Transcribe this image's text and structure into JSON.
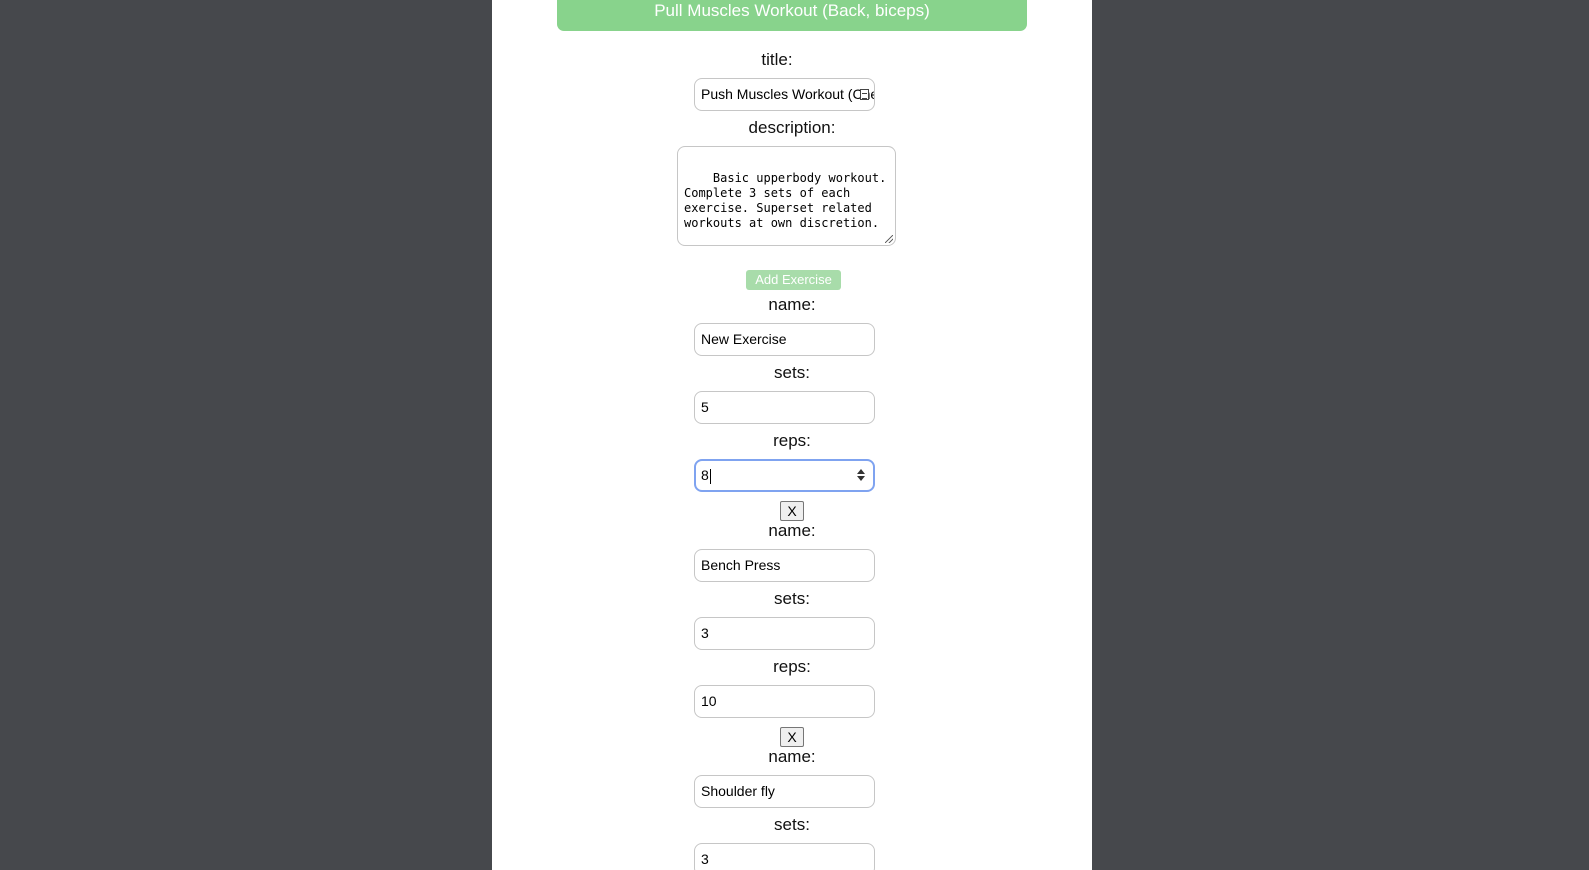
{
  "header": {
    "workout_title": "Pull Muscles Workout (Back, biceps)"
  },
  "form": {
    "title_label": "title:",
    "title_value": "Push Muscles Workout (Che",
    "description_label": "description:",
    "description_value": "Basic upperbody workout.\nComplete 3 sets of each\nexercise. Superset related\nworkouts at own discretion.",
    "add_exercise_label": "Add Exercise"
  },
  "exercises": [
    {
      "name_label": "name:",
      "name_value": "New Exercise",
      "sets_label": "sets:",
      "sets_value": "5",
      "reps_label": "reps:",
      "reps_value": "8",
      "remove_label": "X"
    },
    {
      "name_label": "name:",
      "name_value": "Bench Press",
      "sets_label": "sets:",
      "sets_value": "3",
      "reps_label": "reps:",
      "reps_value": "10",
      "remove_label": "X"
    },
    {
      "name_label": "name:",
      "name_value": "Shoulder fly",
      "sets_label": "sets:",
      "sets_value": "3"
    }
  ],
  "colors": {
    "background": "#46484c",
    "panel": "#ffffff",
    "header_green": "#88d38c",
    "add_button_green": "#a8dcaa",
    "focus_border": "#7fa3f0"
  }
}
